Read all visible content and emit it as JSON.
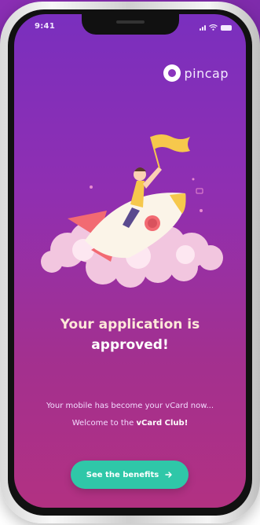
{
  "status_bar": {
    "time": "9:41"
  },
  "brand": {
    "name": "pincap",
    "icon": "pincap-logo-icon"
  },
  "illustration": {
    "icon": "rocket-rider-illustration"
  },
  "headline": {
    "line1": "Your application is",
    "line2": "approved!"
  },
  "message": {
    "line1": "Your mobile has become your vCard now...",
    "line2_prefix": "Welcome to the ",
    "line2_highlight": "vCard Club!"
  },
  "cta": {
    "label": "See the benefits",
    "icon": "arrow-right-icon"
  },
  "colors": {
    "accent_button": "#2fc7a8",
    "screen_top": "#7a2fbe",
    "screen_bottom": "#b23182"
  }
}
